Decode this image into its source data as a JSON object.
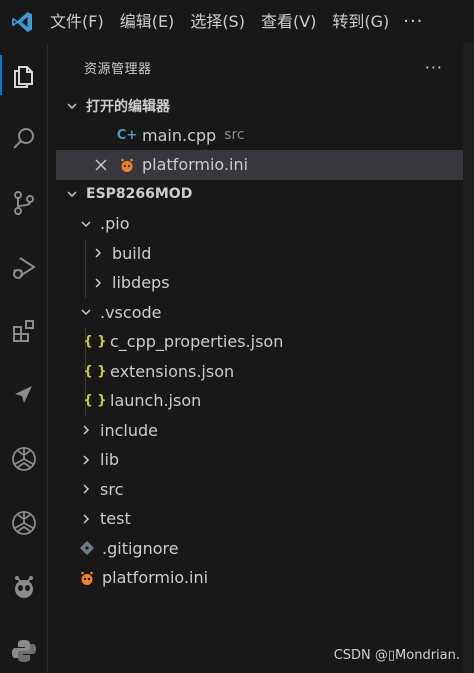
{
  "menubar": {
    "items": [
      "文件(F)",
      "编辑(E)",
      "选择(S)",
      "查看(V)",
      "转到(G)"
    ],
    "more": "···"
  },
  "activitybar": {
    "icons": [
      "explorer-icon",
      "search-icon",
      "source-control-icon",
      "run-debug-icon",
      "extensions-icon",
      "send-icon",
      "chatgpt-icon",
      "chatgpt-icon",
      "platformio-icon",
      "python-icon"
    ]
  },
  "sidebar": {
    "title": "资源管理器",
    "more": "···",
    "open_editors": {
      "label": "打开的编辑器",
      "items": [
        {
          "name": "main.cpp",
          "desc": "src"
        },
        {
          "name": "platformio.ini"
        }
      ]
    },
    "project": {
      "label": "ESP8266MOD",
      "tree": [
        {
          "name": ".pio"
        },
        {
          "name": "build"
        },
        {
          "name": "libdeps"
        },
        {
          "name": ".vscode"
        },
        {
          "name": "c_cpp_properties.json"
        },
        {
          "name": "extensions.json"
        },
        {
          "name": "launch.json"
        },
        {
          "name": "include"
        },
        {
          "name": "lib"
        },
        {
          "name": "src"
        },
        {
          "name": "test"
        },
        {
          "name": ".gitignore"
        },
        {
          "name": "platformio.ini"
        }
      ]
    }
  },
  "icons": {
    "json_icon_text": "{ }",
    "cpp_icon_text": "C+"
  },
  "colors": {
    "accent": "#0078d4",
    "cpp_icon": "#519aba",
    "json_icon": "#cbcb41",
    "platformio_icon": "#f5822a",
    "vscode_logo": "#3c99d4"
  },
  "watermark": "CSDN @▯Mondrian."
}
